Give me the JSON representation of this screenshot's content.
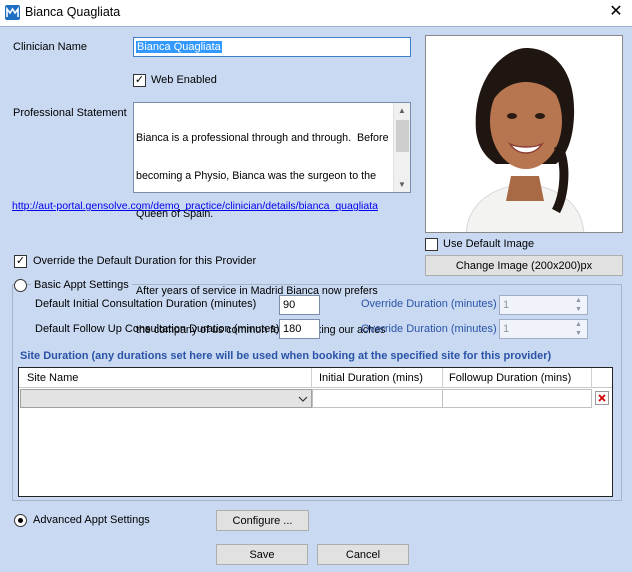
{
  "window": {
    "title": "Bianca  Quagliata",
    "close_glyph": "✕"
  },
  "clinician": {
    "name_label": "Clinician Name",
    "name_value": "Bianca  Quagliata",
    "web_enabled_label": "Web Enabled",
    "web_enabled": true,
    "statement_label": "Professional Statement",
    "statement_lines": [
      "Bianca is a professional through and through.  Before",
      "becoming a Physio, Bianca was the surgeon to the",
      "Queen of Spain.",
      "",
      "After years of service in Madrid Bianca now prefers",
      "the company of us common folk and fixing our aches"
    ],
    "profile_url": "http://aut-portal.gensolve.com/demo_practice/clinician/details/bianca_quagliata"
  },
  "image": {
    "use_default_label": "Use Default Image",
    "use_default": false,
    "change_label": "Change Image (200x200)px"
  },
  "duration": {
    "override_label": "Override the Default Duration for this Provider",
    "override_checked": true,
    "basic_label": "Basic Appt Settings",
    "initial_label": "Default Initial Consultation Duration (minutes)",
    "initial_value": "90",
    "followup_label": "Default Follow Up Consultation Duration (minutes)",
    "followup_value": "180",
    "override_duration_label": "Override Duration (minutes)",
    "override_initial_value": "1",
    "override_followup_value": "1"
  },
  "site": {
    "heading": "Site Duration (any durations set here will be used when booking at the specified site for this provider)",
    "columns": [
      "Site Name",
      "Initial Duration (mins)",
      "Followup Duration (mins)"
    ]
  },
  "advanced": {
    "label": "Advanced Appt Settings",
    "selected": true,
    "configure_label": "Configure ..."
  },
  "footer": {
    "save_label": "Save",
    "cancel_label": "Cancel"
  },
  "icons": {
    "app": "app-logo-icon",
    "close": "close-icon",
    "check": "checkmark-icon",
    "dropdown": "chevron-down-icon",
    "delete": "delete-row-icon",
    "spin": "spinner-arrows-icon"
  },
  "colors": {
    "background": "#c9d9f2",
    "link": "#0000ee",
    "site_heading": "#2a53a6",
    "delete": "#cc0000"
  }
}
